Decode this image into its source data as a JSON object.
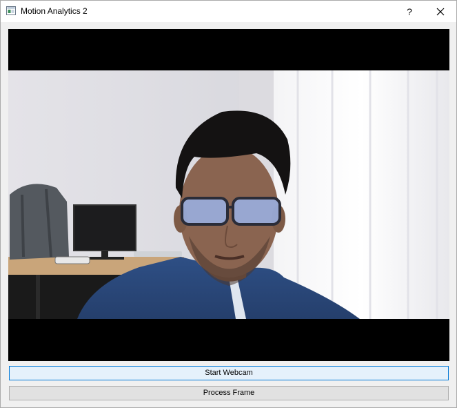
{
  "window": {
    "title": "Motion Analytics 2",
    "help_glyph": "?",
    "close_glyph": "✕"
  },
  "video": {
    "content": "webcam-frame"
  },
  "buttons": {
    "start_webcam": "Start Webcam",
    "process_frame": "Process Frame"
  },
  "colors": {
    "focus_border": "#0078d7",
    "button_bg": "#e1e1e1",
    "video_bg": "#000000"
  }
}
